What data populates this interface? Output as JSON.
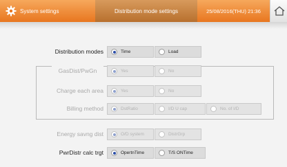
{
  "header": {
    "title": "System settings",
    "mode_tab": "Distribution mode settings",
    "datetime": "25/08/2016(THU) 21:36"
  },
  "settings": {
    "distribution_modes": {
      "label": "Distribution modes",
      "options": [
        "Time",
        "Load"
      ],
      "selected": "Time"
    },
    "group_title": "GasDist/PwGn",
    "gasdist": {
      "options": [
        "Yes",
        "No"
      ],
      "selected": "Yes"
    },
    "charge_each_area": {
      "label": "Charge each area",
      "options": [
        "Yes",
        "No"
      ],
      "selected": "Yes"
    },
    "billing_method": {
      "label": "Billing method",
      "options": [
        "DstRatio",
        "I/D U cap",
        "No. of I/D"
      ],
      "selected": "DstRatio"
    },
    "energy_saving_dist": {
      "label": "Energy savng dist",
      "options": [
        "O/D system",
        "DistrGrp"
      ],
      "selected": "O/D system"
    },
    "pwrdistr_calc_trgt": {
      "label": "PwrDistr calc trgt",
      "options": [
        "OpertnTime",
        "T/S ONTime"
      ],
      "selected": "OpertnTime"
    }
  }
}
